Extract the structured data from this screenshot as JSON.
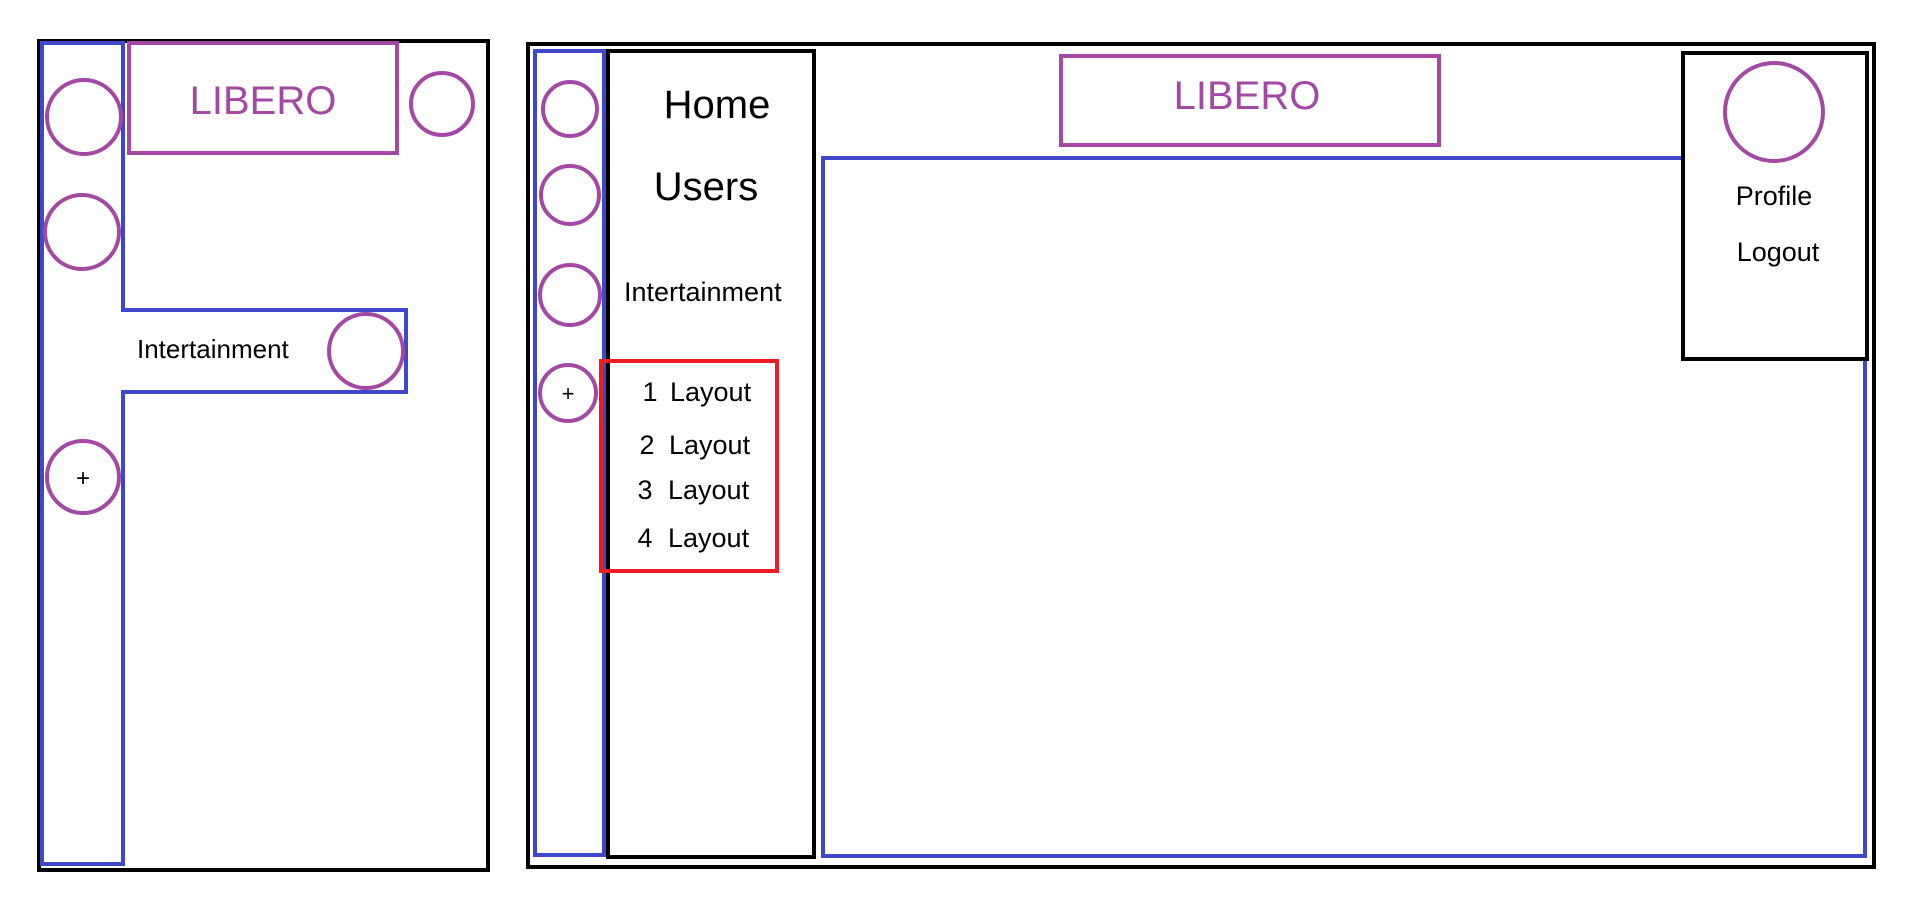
{
  "colors": {
    "frame": "#000000",
    "rail": "#3f48cc",
    "accent": "#a349a4",
    "highlight": "#ed1c24"
  },
  "mobile": {
    "logo_text": "LIBERO",
    "entertainment_label": "Intertainment",
    "add_symbol": "+"
  },
  "desktop": {
    "logo_text": "LIBERO",
    "nav": {
      "home": "Home",
      "users": "Users",
      "entertainment": "Intertainment"
    },
    "add_symbol": "+",
    "layouts": [
      {
        "number": "1",
        "label": "Layout"
      },
      {
        "number": "2",
        "label": "Layout"
      },
      {
        "number": "3",
        "label": "Layout"
      },
      {
        "number": "4",
        "label": "Layout"
      }
    ],
    "profile_menu": {
      "profile": "Profile",
      "logout": "Logout"
    }
  }
}
